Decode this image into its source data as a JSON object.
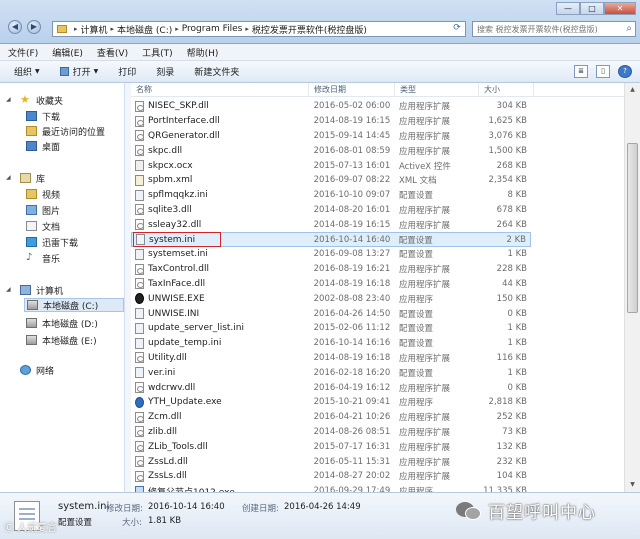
{
  "window": {
    "breadcrumbs": [
      "计算机",
      "本地磁盘 (C:)",
      "Program Files",
      "税控发票开票软件(税控盘版)"
    ],
    "search_placeholder": "搜索 税控发票开票软件(税控盘版)",
    "controls": {
      "minimize": "—",
      "maximize": "□",
      "close": "✕"
    }
  },
  "menu": [
    "文件(F)",
    "编辑(E)",
    "查看(V)",
    "工具(T)",
    "帮助(H)"
  ],
  "toolbar": {
    "organize": "组织",
    "open": "打开",
    "print": "打印",
    "burn": "刻录",
    "new_folder": "新建文件夹"
  },
  "nav": {
    "favorites": "收藏夹",
    "downloads": "下载",
    "recent": "最近访问的位置",
    "desktop": "桌面",
    "libraries": "库",
    "videos": "视频",
    "pictures": "图片",
    "documents": "文档",
    "thunder": "迅雷下载",
    "music": "音乐",
    "computer": "计算机",
    "drive_c": "本地磁盘 (C:)",
    "drive_d": "本地磁盘 (D:)",
    "drive_e": "本地磁盘 (E:)",
    "network": "网络"
  },
  "columns": {
    "name": "名称",
    "date": "修改日期",
    "type": "类型",
    "size": "大小"
  },
  "files": [
    {
      "name": "NISEC_SKP.dll",
      "date": "2016-05-02 06:00",
      "type": "应用程序扩展",
      "size": "304 KB",
      "icon": "dll"
    },
    {
      "name": "PortInterface.dll",
      "date": "2014-08-19 16:15",
      "type": "应用程序扩展",
      "size": "1,625 KB",
      "icon": "dll"
    },
    {
      "name": "QRGenerator.dll",
      "date": "2015-09-14 14:45",
      "type": "应用程序扩展",
      "size": "3,076 KB",
      "icon": "dll"
    },
    {
      "name": "skpc.dll",
      "date": "2016-08-01 08:59",
      "type": "应用程序扩展",
      "size": "1,500 KB",
      "icon": "dll"
    },
    {
      "name": "skpcx.ocx",
      "date": "2015-07-13 16:01",
      "type": "ActiveX 控件",
      "size": "268 KB",
      "icon": "ocx"
    },
    {
      "name": "spbm.xml",
      "date": "2016-09-07 08:22",
      "type": "XML 文档",
      "size": "2,354 KB",
      "icon": "xml"
    },
    {
      "name": "spflmqqkz.ini",
      "date": "2016-10-10 09:07",
      "type": "配置设置",
      "size": "8 KB",
      "icon": "ini"
    },
    {
      "name": "sqlite3.dll",
      "date": "2014-08-20 16:01",
      "type": "应用程序扩展",
      "size": "678 KB",
      "icon": "dll"
    },
    {
      "name": "ssleay32.dll",
      "date": "2014-08-19 16:15",
      "type": "应用程序扩展",
      "size": "264 KB",
      "icon": "dll"
    },
    {
      "name": "system.ini",
      "date": "2016-10-14 16:40",
      "type": "配置设置",
      "size": "2 KB",
      "icon": "ini"
    },
    {
      "name": "systemset.ini",
      "date": "2016-09-08 13:27",
      "type": "配置设置",
      "size": "1 KB",
      "icon": "ini"
    },
    {
      "name": "TaxControl.dll",
      "date": "2016-08-19 16:21",
      "type": "应用程序扩展",
      "size": "228 KB",
      "icon": "dll"
    },
    {
      "name": "TaxInFace.dll",
      "date": "2014-08-19 16:18",
      "type": "应用程序扩展",
      "size": "44 KB",
      "icon": "dll"
    },
    {
      "name": "UNWISE.EXE",
      "date": "2002-08-08 23:40",
      "type": "应用程序",
      "size": "150 KB",
      "icon": "exe-black"
    },
    {
      "name": "UNWISE.INI",
      "date": "2016-04-26 14:50",
      "type": "配置设置",
      "size": "0 KB",
      "icon": "ini"
    },
    {
      "name": "update_server_list.ini",
      "date": "2015-02-06 11:12",
      "type": "配置设置",
      "size": "1 KB",
      "icon": "ini"
    },
    {
      "name": "update_temp.ini",
      "date": "2016-10-14 16:16",
      "type": "配置设置",
      "size": "1 KB",
      "icon": "ini"
    },
    {
      "name": "Utility.dll",
      "date": "2014-08-19 16:18",
      "type": "应用程序扩展",
      "size": "116 KB",
      "icon": "dll"
    },
    {
      "name": "ver.ini",
      "date": "2016-02-18 16:20",
      "type": "配置设置",
      "size": "1 KB",
      "icon": "ini"
    },
    {
      "name": "wdcrwv.dll",
      "date": "2016-04-19 16:12",
      "type": "应用程序扩展",
      "size": "0 KB",
      "icon": "dll"
    },
    {
      "name": "YTH_Update.exe",
      "date": "2015-10-21 09:41",
      "type": "应用程序",
      "size": "2,818 KB",
      "icon": "exe-blue"
    },
    {
      "name": "Zcm.dll",
      "date": "2016-04-21 10:26",
      "type": "应用程序扩展",
      "size": "252 KB",
      "icon": "dll"
    },
    {
      "name": "zlib.dll",
      "date": "2014-08-26 08:51",
      "type": "应用程序扩展",
      "size": "73 KB",
      "icon": "dll"
    },
    {
      "name": "ZLib_Tools.dll",
      "date": "2015-07-17 16:31",
      "type": "应用程序扩展",
      "size": "132 KB",
      "icon": "dll"
    },
    {
      "name": "ZssLd.dll",
      "date": "2016-05-11 15:31",
      "type": "应用程序扩展",
      "size": "232 KB",
      "icon": "dll"
    },
    {
      "name": "ZssLs.dll",
      "date": "2014-08-27 20:02",
      "type": "应用程序扩展",
      "size": "104 KB",
      "icon": "dll"
    },
    {
      "name": "修复父节点1012.exe",
      "date": "2016-09-29 17:49",
      "type": "应用程序",
      "size": "11,335 KB",
      "icon": "exe"
    }
  ],
  "selected_file": "system.ini",
  "details": {
    "name": "system.ini",
    "modified_label": "修改日期:",
    "modified": "2016-10-14 16:40",
    "created_label": "创建日期:",
    "created": "2016-04-26 14:49",
    "type": "配置设置",
    "size_label": "大小:",
    "size": "1.81 KB"
  },
  "watermarks": {
    "left": "Ⓒ 人贰复言",
    "right": "百望呼叫中心"
  },
  "colors": {
    "selection": "#dfeefc",
    "highlight_box": "#d0252b"
  }
}
